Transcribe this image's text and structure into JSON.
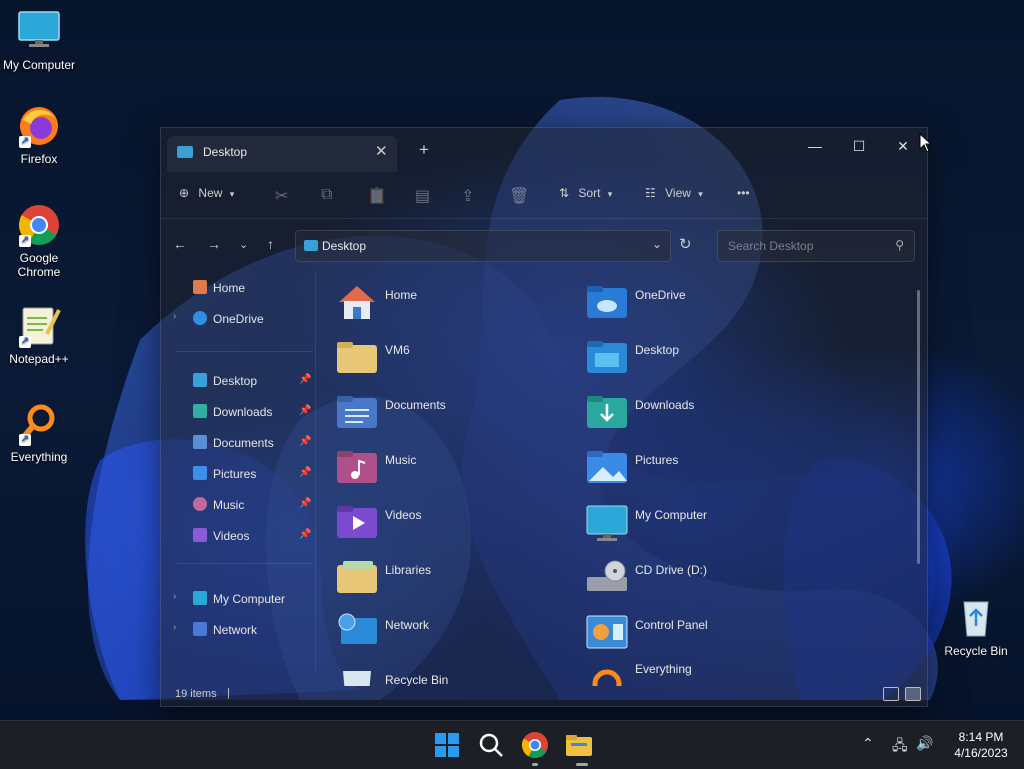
{
  "colors": {
    "accent": "#3aa0d8",
    "taskbar": "#1c1f26",
    "window_bg": "rgba(32,36,48,0.55)"
  },
  "desktop": {
    "icons": [
      {
        "label": "My Computer",
        "icon": "monitor-icon"
      },
      {
        "label": "Firefox",
        "icon": "firefox-icon"
      },
      {
        "label": "Google Chrome",
        "icon": "chrome-icon"
      },
      {
        "label": "Notepad++",
        "icon": "notepadpp-icon"
      },
      {
        "label": "Everything",
        "icon": "everything-icon"
      }
    ],
    "recycle_bin": {
      "label": "Recycle Bin",
      "icon": "recycle-bin-icon"
    }
  },
  "window": {
    "tab_title": "Desktop",
    "new_tab": "+",
    "toolbar": {
      "new_label": "New",
      "sort_label": "Sort",
      "view_label": "View",
      "more": "•••"
    },
    "address": {
      "path": "Desktop"
    },
    "search": {
      "placeholder": "Search Desktop"
    },
    "nav": {
      "top": [
        {
          "label": "Home",
          "icon": "home-icon"
        },
        {
          "label": "OneDrive",
          "icon": "cloud-icon"
        }
      ],
      "pinned": [
        {
          "label": "Desktop",
          "icon": "desktop-folder-icon"
        },
        {
          "label": "Downloads",
          "icon": "download-icon"
        },
        {
          "label": "Documents",
          "icon": "documents-icon"
        },
        {
          "label": "Pictures",
          "icon": "pictures-icon"
        },
        {
          "label": "Music",
          "icon": "music-icon"
        },
        {
          "label": "Videos",
          "icon": "videos-icon"
        }
      ],
      "bottom": [
        {
          "label": "My Computer",
          "icon": "monitor-icon"
        },
        {
          "label": "Network",
          "icon": "network-icon"
        }
      ]
    },
    "items": [
      {
        "label": "Home",
        "icon": "home-icon"
      },
      {
        "label": "OneDrive",
        "icon": "cloud-folder-icon"
      },
      {
        "label": "VM6",
        "icon": "folder-icon"
      },
      {
        "label": "Desktop",
        "icon": "desktop-folder-icon"
      },
      {
        "label": "Documents",
        "icon": "documents-folder-icon"
      },
      {
        "label": "Downloads",
        "icon": "downloads-folder-icon"
      },
      {
        "label": "Music",
        "icon": "music-folder-icon"
      },
      {
        "label": "Pictures",
        "icon": "pictures-folder-icon"
      },
      {
        "label": "Videos",
        "icon": "videos-folder-icon"
      },
      {
        "label": "My Computer",
        "icon": "monitor-icon"
      },
      {
        "label": "Libraries",
        "icon": "libraries-icon"
      },
      {
        "label": "CD Drive (D:)",
        "icon": "cd-drive-icon"
      },
      {
        "label": "Network",
        "icon": "network-icon"
      },
      {
        "label": "Control Panel",
        "icon": "control-panel-icon"
      },
      {
        "label": "Recycle Bin",
        "icon": "recycle-bin-icon"
      },
      {
        "label": "Everything",
        "icon": "everything-icon"
      }
    ],
    "status": {
      "count": "19 items"
    }
  },
  "taskbar": {
    "apps": [
      "start-icon",
      "search-icon",
      "chrome-icon",
      "file-explorer-icon"
    ],
    "clock": {
      "time": "8:14 PM",
      "date": "4/16/2023"
    }
  }
}
